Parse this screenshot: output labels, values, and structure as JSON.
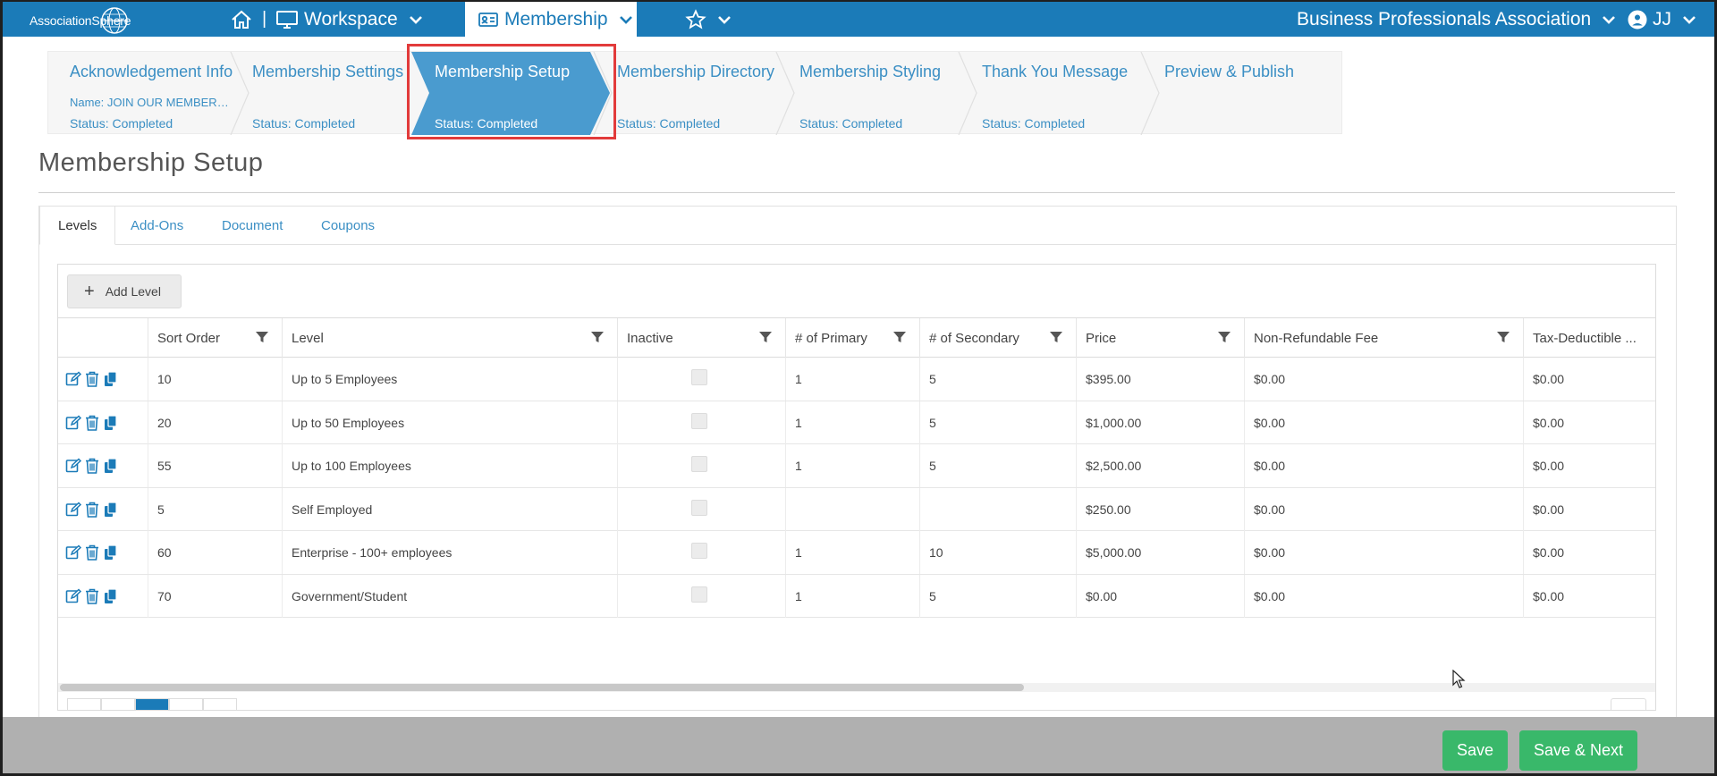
{
  "topbar": {
    "logo_text": "AssociationSphere",
    "workspace_label": "Workspace",
    "membership_label": "Membership",
    "org_name": "Business Professionals Association",
    "user_initials": "JJ",
    "accent_color": "#1b7bb8"
  },
  "steps": [
    {
      "title": "Acknowledgement Info",
      "name": "Name: JOIN OUR MEMBERSHIP",
      "status": "Status: Completed"
    },
    {
      "title": "Membership Settings",
      "status": "Status: Completed"
    },
    {
      "title": "Membership Setup",
      "status": "Status: Completed"
    },
    {
      "title": "Membership Directory",
      "status": "Status: Completed"
    },
    {
      "title": "Membership Styling",
      "status": "Status: Completed"
    },
    {
      "title": "Thank You Message",
      "status": "Status: Completed"
    },
    {
      "title": "Preview & Publish"
    }
  ],
  "page_title": "Membership Setup",
  "tabs": [
    "Levels",
    "Add-Ons",
    "Document",
    "Coupons"
  ],
  "grid": {
    "add_label": "Add Level",
    "columns": [
      "Sort Order",
      "Level",
      "Inactive",
      "# of Primary",
      "# of Secondary",
      "Price",
      "Non-Refundable Fee",
      "Tax-Deductible ..."
    ],
    "rows": [
      {
        "sort": "10",
        "level": "Up to 5 Employees",
        "primary": "1",
        "secondary": "5",
        "price": "$395.00",
        "fee": "$0.00",
        "tax": "$0.00"
      },
      {
        "sort": "20",
        "level": "Up to 50 Employees",
        "primary": "1",
        "secondary": "5",
        "price": "$1,000.00",
        "fee": "$0.00",
        "tax": "$0.00"
      },
      {
        "sort": "55",
        "level": "Up to 100 Employees",
        "primary": "1",
        "secondary": "5",
        "price": "$2,500.00",
        "fee": "$0.00",
        "tax": "$0.00"
      },
      {
        "sort": "5",
        "level": "Self Employed",
        "primary": "",
        "secondary": "",
        "price": "$250.00",
        "fee": "$0.00",
        "tax": "$0.00"
      },
      {
        "sort": "60",
        "level": "Enterprise - 100+ employees",
        "primary": "1",
        "secondary": "10",
        "price": "$5,000.00",
        "fee": "$0.00",
        "tax": "$0.00"
      },
      {
        "sort": "70",
        "level": "Government/Student",
        "primary": "1",
        "secondary": "5",
        "price": "$0.00",
        "fee": "$0.00",
        "tax": "$0.00"
      }
    ]
  },
  "footer": {
    "save_label": "Save",
    "save_next_label": "Save & Next",
    "button_color": "#39b86a"
  }
}
